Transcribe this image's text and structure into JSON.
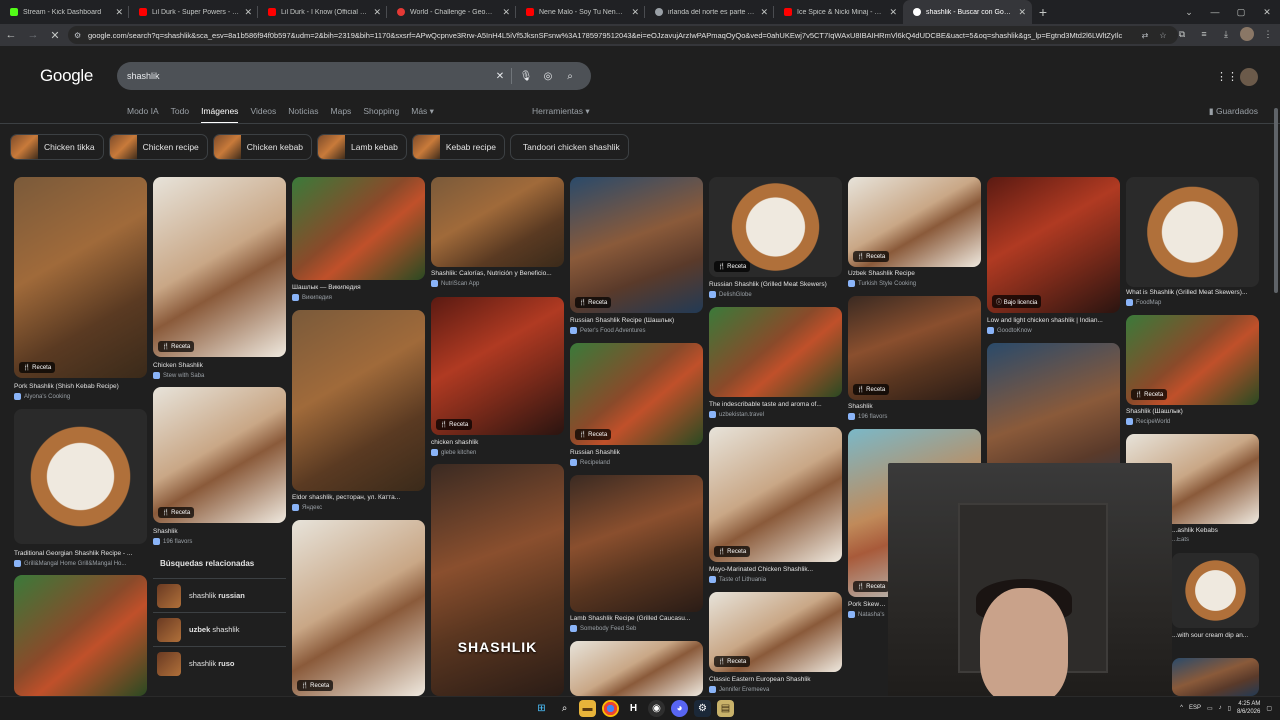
{
  "browser": {
    "tabs": [
      {
        "title": "Stream - Kick Dashboard",
        "color": "#53fc18"
      },
      {
        "title": "Lil Durk - Super Powers - YouTu",
        "color": "#ff0000"
      },
      {
        "title": "Lil Durk - I Know (Official Video",
        "color": "#ff0000"
      },
      {
        "title": "World - Challenge - GeoGuessr",
        "color": "#e53935"
      },
      {
        "title": "Nene Malo - Soy Tu Nene Malo",
        "color": "#ff0000"
      },
      {
        "title": "irlanda del norte es parte de la",
        "color": "#9aa0a6"
      },
      {
        "title": "Ice Spice & Nicki Minaj - Princ",
        "color": "#ff0000"
      },
      {
        "title": "shashlik - Buscar con Google",
        "color": "#9aa0a6",
        "active": true
      }
    ],
    "url": "google.com/search?q=shashlik&sca_esv=8a1b586f94f0b597&udm=2&bih=2319&bih=1170&sxsrf=APwQcpnve3Rrw-A5InH4L5iVf5JksnSFsnw%3A1785979512043&ei=eOJzavujArzIwPAPmaqOyQo&ved=0ahUKEwj7v5CT7IqWAxU8IBAIHRmVl6kQ4dUDCBE&uact=5&oq=shashlik&gs_lp=Egtnd3Mtd2l6LWltZyIlc"
  },
  "google": {
    "logo": "Google",
    "query": "shashlik",
    "nav": [
      "Modo IA",
      "Todo",
      "Imágenes",
      "Videos",
      "Noticias",
      "Maps",
      "Shopping",
      "Más"
    ],
    "active_nav": "Imágenes",
    "tools": "Herramientas",
    "saved": "Guardados",
    "chips": [
      "Chicken tikka",
      "Chicken recipe",
      "Chicken kebab",
      "Lamb kebab",
      "Kebab recipe",
      "Tandoori chicken shashlik"
    ],
    "badge": "Receta",
    "badge_license": "Bajo licencia",
    "results": [
      {
        "title": "Pork Shashlik (Shish Kebab Recipe)",
        "source": "Alyona's Cooking"
      },
      {
        "title": "Traditional Georgian Shashlik Recipe - ...",
        "source": "Grill&Mangal Home Grill&Mangal Ho..."
      },
      {
        "title": "Chicken Shashlik",
        "source": "Stew with Saba"
      },
      {
        "title": "Shashlik",
        "source": "196 flavors"
      },
      {
        "title": "Шашлык — Википедия",
        "source": "Википедия"
      },
      {
        "title": "Eldor shashlik, ресторан, ул. Катта...",
        "source": "Яндекс"
      },
      {
        "title": "Shashlik: Calorías, Nutrición y Beneficio...",
        "source": "NutriScan App"
      },
      {
        "title": "chicken shashlik",
        "source": "glebe kitchen"
      },
      {
        "title": "Russian Shashlik Recipe (Шашлык)",
        "source": "Peter's Food Adventures"
      },
      {
        "title": "Russian Shashlik",
        "source": "Recipeland"
      },
      {
        "title": "Lamb Shashlik Recipe (Grilled Caucasu...",
        "source": "Somebody Feed Seb"
      },
      {
        "title": "Russian Shashlik (Grilled Meat Skewers)",
        "source": "DelishGlobe"
      },
      {
        "title": "The indescribable taste and aroma of...",
        "source": "uzbekistan.travel"
      },
      {
        "title": "Mayo-Marinated Chicken Shashlik...",
        "source": "Taste of Lithuania"
      },
      {
        "title": "Classic Eastern European Shashlik",
        "source": "Jennifer Eremeeva"
      },
      {
        "title": "Uzbek Shashlik Recipe",
        "source": "Turkish Style Cooking"
      },
      {
        "title": "Shashlik",
        "source": "196 flavors"
      },
      {
        "title": "Pork Skewers",
        "source": "Natasha's"
      },
      {
        "title": "Low and light chicken shashlik | Indian...",
        "source": "GoodtoKnow"
      },
      {
        "title": "What is Shashlik (Grilled Meat Skewers)...",
        "source": "FoodMap"
      },
      {
        "title": "Shashlik (Шашлык)",
        "source": "RecipeWorld"
      },
      {
        "title": "...ashlik Kebabs",
        "source": "...Eats"
      },
      {
        "title": "...with sour cream dip an...",
        "source": ""
      }
    ],
    "overlay_text": "SHASHLIK",
    "related_title": "Búsquedas relacionadas",
    "related": [
      {
        "bold": "shashlik",
        "rest": " russian",
        "bold_first": false
      },
      {
        "bold": "uzbek",
        "rest": " shashlik",
        "bold_first": true
      },
      {
        "bold": "shashlik",
        "rest": " ruso",
        "bold_first": false
      }
    ]
  },
  "taskbar": {
    "lang": "ESP",
    "time": "4:25 AM",
    "date": "8/6/2026"
  }
}
